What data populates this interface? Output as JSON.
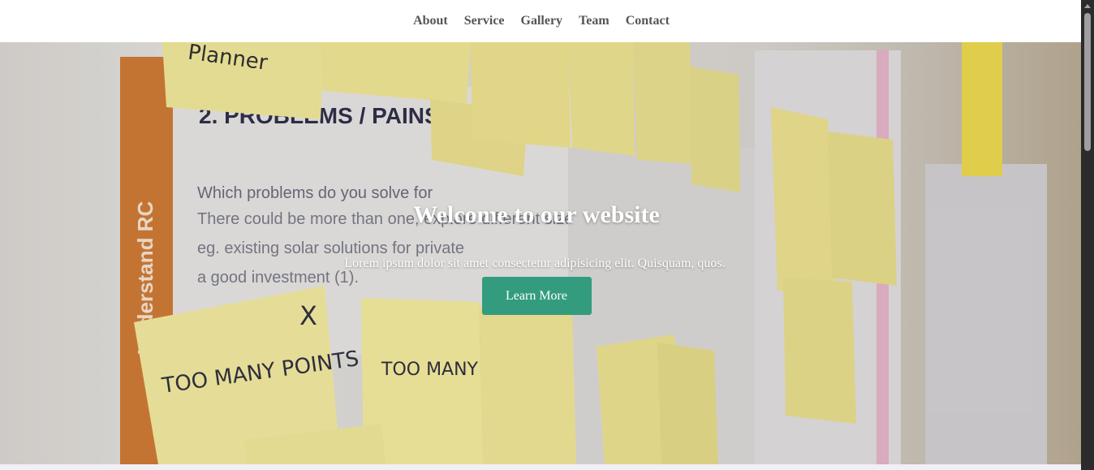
{
  "nav": {
    "items": [
      {
        "label": "About"
      },
      {
        "label": "Service"
      },
      {
        "label": "Gallery"
      },
      {
        "label": "Team"
      },
      {
        "label": "Contact"
      }
    ]
  },
  "hero": {
    "title": "Welcome to our website",
    "subtitle": "Lorem ipsum dolor sit amet consectetur adipisicing elit. Quisquam, quos.",
    "button_label": "Learn More",
    "background": {
      "icon": "sticky-notes-board-photo-icon",
      "heading": "2. PROBLEMS / PAINS",
      "side_label": "Understand RC",
      "text_lines": [
        "Which problems do you solve for",
        "There could be more than one, explore different sizes.",
        "eg. existing solar solutions for private",
        "a good investment (1)."
      ],
      "notes": [
        "Planner",
        "X",
        "TOO MANY POINTS FOR COMPARISON",
        "TOO MANY TABS"
      ]
    }
  },
  "colors": {
    "accent": "#339c7e",
    "nav_text": "#555555",
    "hero_text": "#ffffff"
  }
}
